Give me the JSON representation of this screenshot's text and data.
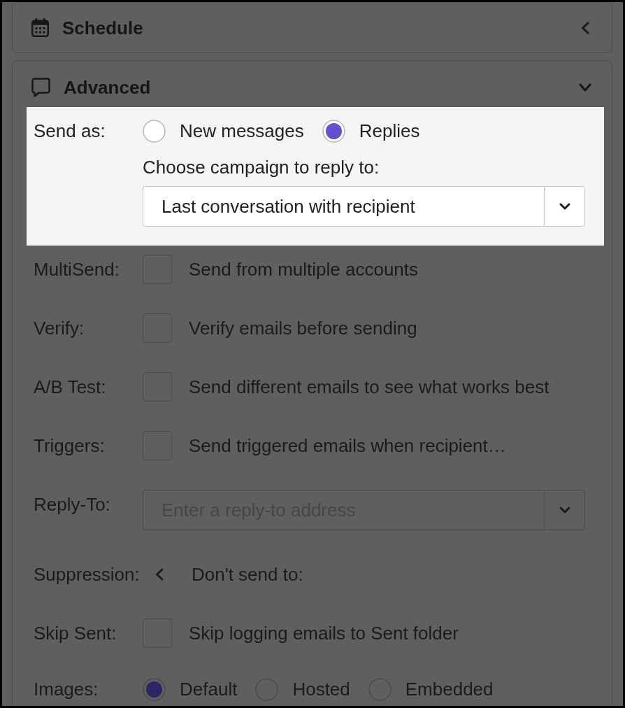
{
  "sections": [
    {
      "title": "Schedule",
      "expanded": false
    },
    {
      "title": "Advanced",
      "expanded": true,
      "rows": [
        {
          "kind": "radio",
          "label": "Send as:",
          "highlighted": true,
          "options": [
            {
              "label": "New messages",
              "selected": false
            },
            {
              "label": "Replies",
              "selected": true
            }
          ],
          "sub_label": "Choose campaign to reply to:",
          "select": {
            "value": "Last conversation with recipient"
          }
        },
        {
          "kind": "checkbox",
          "label": "MultiSend:",
          "highlighted": false,
          "text": "Send from multiple accounts",
          "checked": false
        },
        {
          "kind": "checkbox",
          "label": "Verify:",
          "highlighted": false,
          "text": "Verify emails before sending",
          "checked": false
        },
        {
          "kind": "checkbox",
          "label": "A/B Test:",
          "highlighted": false,
          "text": "Send different emails to see what works best",
          "checked": false
        },
        {
          "kind": "checkbox",
          "label": "Triggers:",
          "highlighted": false,
          "text": "Send triggered emails when recipient…",
          "checked": false
        },
        {
          "kind": "combo",
          "label": "Reply-To:",
          "highlighted": false,
          "placeholder": "Enter a reply-to address"
        },
        {
          "kind": "collapsible",
          "label": "Suppression:",
          "highlighted": false,
          "expanded": false,
          "text": "Don't send to:"
        },
        {
          "kind": "checkbox",
          "label": "Skip Sent:",
          "highlighted": false,
          "text": "Skip logging emails to Sent folder",
          "checked": false
        },
        {
          "kind": "radio",
          "label": "Images:",
          "highlighted": false,
          "options": [
            {
              "label": "Default",
              "selected": true
            },
            {
              "label": "Hosted",
              "selected": false
            },
            {
              "label": "Embedded",
              "selected": false
            }
          ]
        }
      ]
    }
  ]
}
